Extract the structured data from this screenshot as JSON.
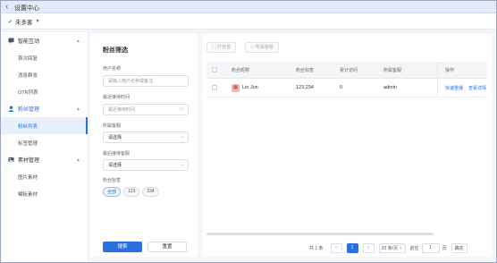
{
  "window": {
    "title": "设置中心"
  },
  "topbar": {
    "account_name": "未多客"
  },
  "sidebar": {
    "groups": [
      {
        "label": "智能互动",
        "icon": "chat-icon",
        "items": [
          "首次回复",
          "消息群发",
          "OTN列表"
        ]
      },
      {
        "label": "粉丝管理",
        "icon": "user-icon",
        "items": [
          "粉丝列表",
          "标签管理"
        ]
      },
      {
        "label": "素材管理",
        "icon": "image-icon",
        "items": [
          "图片素材",
          "模板素材"
        ]
      }
    ],
    "active_item": "粉丝列表"
  },
  "filter": {
    "title": "粉丝筛选",
    "fields": [
      {
        "label": "用户名称",
        "placeholder": "请输入用户名称或备注"
      },
      {
        "label": "最近接待时间",
        "placeholder": "最近接待时间"
      },
      {
        "label": "所属客服",
        "value": "请选择"
      },
      {
        "label": "最后接待客服",
        "value": "请选择"
      }
    ],
    "tags_label": "粉丝标签",
    "tags": [
      "全部",
      "123",
      "234"
    ],
    "search_label": "搜索",
    "reset_label": "重置"
  },
  "toolbar": {
    "tag_label": "打标签",
    "assign_label": "所属客服"
  },
  "table": {
    "columns": [
      "粉丝昵称",
      "粉丝标签",
      "累计访问",
      "所属客服",
      "操作"
    ],
    "rows": [
      {
        "nickname": "Lin Jun",
        "tags": "123,234",
        "visits": "0",
        "agent": "admin",
        "actions": [
          "快速重播",
          "查看详情"
        ]
      }
    ]
  },
  "pagination": {
    "total": "共 1 条",
    "current_page": "1",
    "page_size": "20 条/页",
    "goto_label": "前往",
    "goto_value": "1",
    "page_unit": "页",
    "confirm_label": "确定"
  },
  "colors": {
    "accent": "#2d6fe0",
    "titlebar": "#e4ebf8"
  }
}
